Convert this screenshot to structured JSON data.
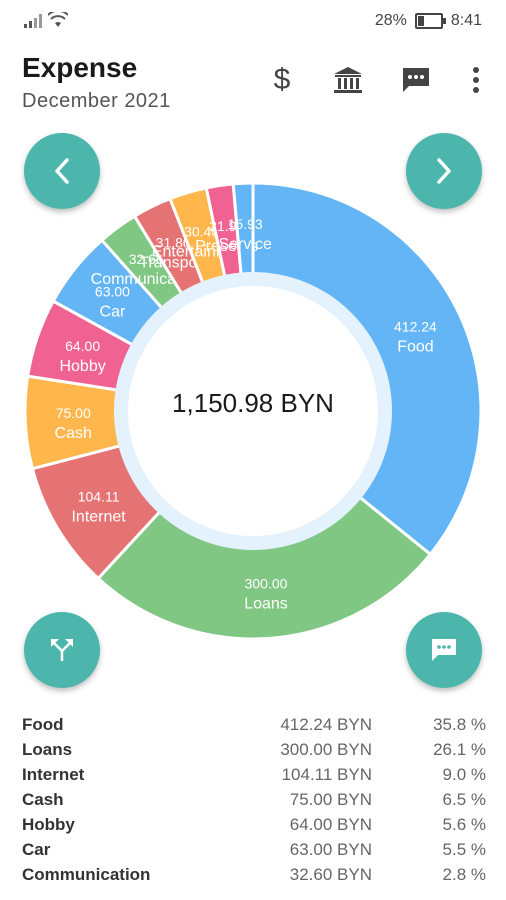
{
  "status_bar": {
    "battery": "28%",
    "time": "8:41"
  },
  "header": {
    "title": "Expense",
    "subtitle": "December 2021"
  },
  "toolbar": {
    "icons": [
      "dollar-icon",
      "bank-icon",
      "comment-icon",
      "more-vert-icon"
    ]
  },
  "nav": {
    "prev_icon": "chevron-left-icon",
    "next_icon": "chevron-right-icon"
  },
  "fabs": {
    "left_icon": "split-arrows-icon",
    "right_icon": "chat-icon"
  },
  "chart_data": {
    "type": "pie",
    "center_label": "1,150.98 BYN",
    "slices": [
      {
        "name": "Food",
        "value": 412.24,
        "label": "412.24",
        "color": "#64b5f6"
      },
      {
        "name": "Loans",
        "value": 300.0,
        "label": "300.00",
        "color": "#81c784"
      },
      {
        "name": "Internet",
        "value": 104.11,
        "label": "104.11",
        "color": "#e57373"
      },
      {
        "name": "Cash",
        "value": 75.0,
        "label": "75.00",
        "color": "#ffb74d"
      },
      {
        "name": "Hobby",
        "value": 64.0,
        "label": "64.00",
        "color": "#f06292"
      },
      {
        "name": "Car",
        "value": 63.0,
        "label": "63.00",
        "color": "#64b5f6"
      },
      {
        "name": "Communication",
        "value": 32.6,
        "label": "32.60",
        "color": "#81c784"
      },
      {
        "name": "Transport",
        "value": 31.8,
        "label": "31.80",
        "color": "#e57373"
      },
      {
        "name": "Entertainment",
        "value": 30.4,
        "label": "30.40",
        "color": "#ffb74d"
      },
      {
        "name": "Presents",
        "value": 21.9,
        "label": "21.90",
        "color": "#f06292"
      },
      {
        "name": "Service",
        "value": 15.93,
        "label": "15.93",
        "color": "#64b5f6"
      }
    ]
  },
  "legend": [
    {
      "name": "Food",
      "amount": "412.24 BYN",
      "percent": "35.8 %"
    },
    {
      "name": "Loans",
      "amount": "300.00 BYN",
      "percent": "26.1 %"
    },
    {
      "name": "Internet",
      "amount": "104.11 BYN",
      "percent": "9.0 %"
    },
    {
      "name": "Cash",
      "amount": "75.00 BYN",
      "percent": "6.5 %"
    },
    {
      "name": "Hobby",
      "amount": "64.00 BYN",
      "percent": "5.6 %"
    },
    {
      "name": "Car",
      "amount": "63.00 BYN",
      "percent": "5.5 %"
    },
    {
      "name": "Communication",
      "amount": "32.60 BYN",
      "percent": "2.8 %"
    }
  ]
}
